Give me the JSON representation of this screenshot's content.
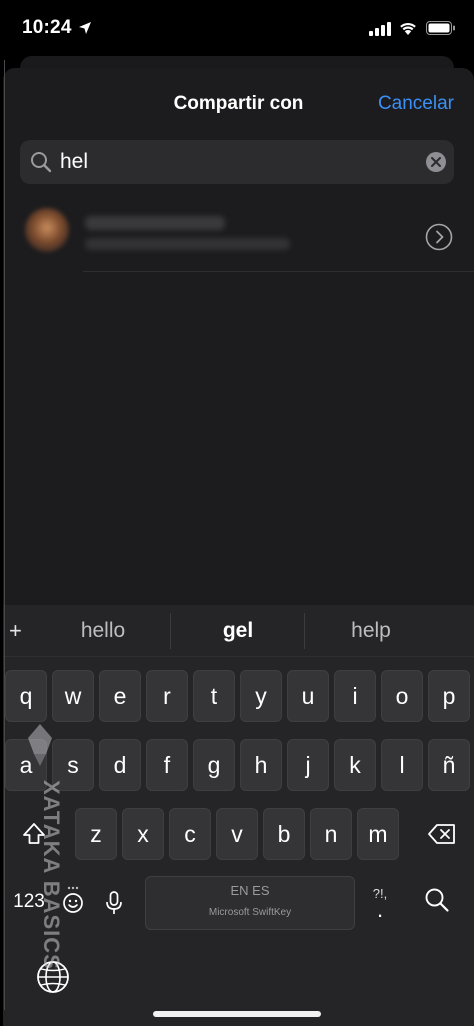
{
  "status_bar": {
    "time": "10:24",
    "icons": [
      "location-arrow-icon",
      "cellular-signal-icon",
      "wifi-icon",
      "battery-icon"
    ]
  },
  "share_sheet": {
    "title": "Compartir con",
    "cancel_label": "Cancelar",
    "search": {
      "value": "hel",
      "placeholder": ""
    },
    "results": [
      {
        "avatar": "blurred",
        "icon": "chevron-right-circle-icon"
      }
    ]
  },
  "keyboard": {
    "suggestions": {
      "plus": "+",
      "items": [
        "hello",
        "gel",
        "help"
      ]
    },
    "rows": [
      [
        "q",
        "w",
        "e",
        "r",
        "t",
        "y",
        "u",
        "i",
        "o",
        "p"
      ],
      [
        "a",
        "s",
        "d",
        "f",
        "g",
        "h",
        "j",
        "k",
        "l",
        "ñ"
      ],
      [
        "z",
        "x",
        "c",
        "v",
        "b",
        "n",
        "m"
      ]
    ],
    "numbers_label": "123",
    "space": {
      "languages": "EN ES",
      "brand": "Microsoft SwiftKey"
    },
    "punct_label": "?!,",
    "punct_sub": "."
  },
  "watermark": {
    "text": "XATAKA BASICS"
  },
  "colors": {
    "accent": "#3b8ff6",
    "sheet_bg": "#1c1c1e",
    "keyboard_bg": "#252527",
    "key_bg": "#353538"
  }
}
